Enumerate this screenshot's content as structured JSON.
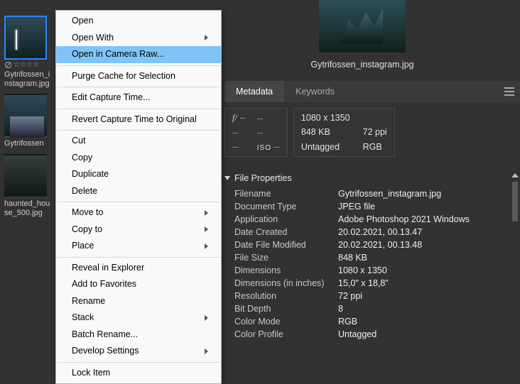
{
  "preview": {
    "filename": "Gytrifossen_instagram.jpg"
  },
  "thumbs": [
    {
      "caption": "Gytrifossen_instagram.jpg",
      "selected": true
    },
    {
      "caption": "Gytrifossen"
    },
    {
      "caption": "haunted_house_500.jpg"
    }
  ],
  "context_menu": {
    "items": [
      {
        "label": "Open"
      },
      {
        "label": "Open With",
        "submenu": true
      },
      {
        "label": "Open in Camera Raw...",
        "highlight": true
      },
      {
        "sep": true
      },
      {
        "label": "Purge Cache for Selection"
      },
      {
        "sep": true
      },
      {
        "label": "Edit Capture Time..."
      },
      {
        "sep": true
      },
      {
        "label": "Revert Capture Time to Original"
      },
      {
        "sep": true
      },
      {
        "label": "Cut"
      },
      {
        "label": "Copy"
      },
      {
        "label": "Duplicate"
      },
      {
        "label": "Delete"
      },
      {
        "sep": true
      },
      {
        "label": "Move to",
        "submenu": true
      },
      {
        "label": "Copy to",
        "submenu": true
      },
      {
        "label": "Place",
        "submenu": true
      },
      {
        "sep": true
      },
      {
        "label": "Reveal in Explorer"
      },
      {
        "label": "Add to Favorites"
      },
      {
        "label": "Rename"
      },
      {
        "label": "Stack",
        "submenu": true
      },
      {
        "label": "Batch Rename..."
      },
      {
        "label": "Develop Settings",
        "submenu": true
      },
      {
        "sep": true
      },
      {
        "label": "Lock Item"
      }
    ]
  },
  "tabs": {
    "metadata": "Metadata",
    "keywords": "Keywords"
  },
  "meta_header": {
    "f_label": "f/",
    "dash": "--",
    "iso_label": "ISO",
    "dimensions": "1080 x 1350",
    "filesize": "848 KB",
    "ppi": "72 ppi",
    "tag": "Untagged",
    "mode": "RGB"
  },
  "file_properties": {
    "title": "File Properties",
    "rows": [
      {
        "k": "Filename",
        "v": "Gytrifossen_instagram.jpg"
      },
      {
        "k": "Document Type",
        "v": "JPEG file"
      },
      {
        "k": "Application",
        "v": "Adobe Photoshop 2021 Windows"
      },
      {
        "k": "Date Created",
        "v": "20.02.2021, 00.13.47"
      },
      {
        "k": "Date File Modified",
        "v": "20.02.2021, 00.13.48"
      },
      {
        "k": "File Size",
        "v": "848 KB"
      },
      {
        "k": "Dimensions",
        "v": "1080 x 1350"
      },
      {
        "k": "Dimensions (in inches)",
        "v": "15,0\" x 18,8\""
      },
      {
        "k": "Resolution",
        "v": "72 ppi"
      },
      {
        "k": "Bit Depth",
        "v": "8"
      },
      {
        "k": "Color Mode",
        "v": "RGB"
      },
      {
        "k": "Color Profile",
        "v": "Untagged"
      }
    ]
  }
}
